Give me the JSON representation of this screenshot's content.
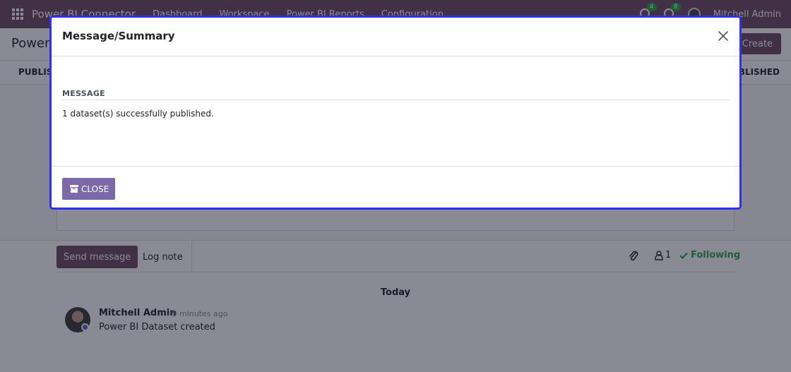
{
  "navbar": {
    "brand": "Power BI Connector",
    "menu": [
      "Dashboard",
      "Workspace",
      "Power BI Reports",
      "Configuration"
    ],
    "messages_count": "4",
    "activities_count": "8",
    "user_name": "Mitchell Admin"
  },
  "control_panel": {
    "breadcrumb": "Power",
    "create_label": "Create"
  },
  "status_bar": {
    "publish_label": "PUBLIS",
    "status_label": "UBLISHED"
  },
  "chatter": {
    "send_message_label": "Send message",
    "log_note_label": "Log note",
    "followers_count": "1",
    "following_label": "Following",
    "date_separator": "Today",
    "message": {
      "author": "Mitchell Admin",
      "date": "- 9 minutes ago",
      "body": "Power BI Dataset created"
    }
  },
  "modal": {
    "title": "Message/Summary",
    "section_label": "MESSAGE",
    "message_text": "1 dataset(s) successfully published.",
    "close_label": "CLOSE"
  },
  "colors": {
    "brand": "#714b67",
    "modal_border": "#2f2ff5",
    "close_button": "#7c6aa8",
    "following": "#28a745"
  }
}
